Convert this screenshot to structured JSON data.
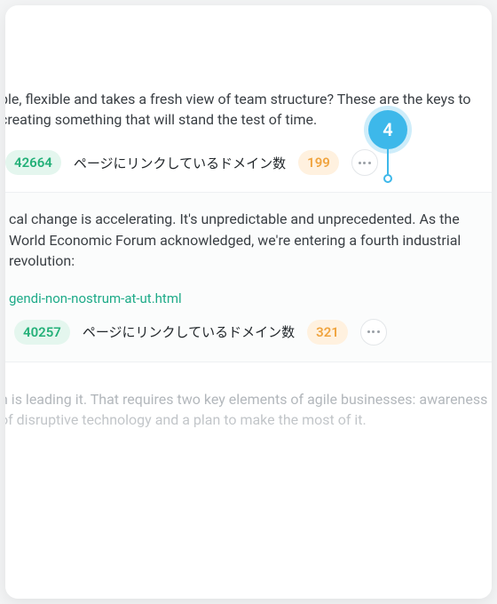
{
  "step_marker": {
    "number": "4"
  },
  "rows": [
    {
      "snippet": "ble, flexible and takes a fresh view of team structure? These are the keys to creating something that will stand the test of time.",
      "backlinks_value": "42664",
      "domains_label": "ページにリンクしているドメイン数",
      "domains_value": "199"
    },
    {
      "snippet": "cal change is accelerating. It's unpredictable and unprecedented. As the World Economic Forum acknowledged, we're entering a fourth industrial revolution:",
      "url_fragment": "gendi-non-nostrum-at-ut.html",
      "backlinks_value": "40257",
      "domains_label": "ページにリンクしているドメイン数",
      "domains_value": "321"
    },
    {
      "snippet": "n is leading it. That requires two key elements of agile businesses: awareness of disruptive technology and a plan to make the most of it."
    }
  ]
}
